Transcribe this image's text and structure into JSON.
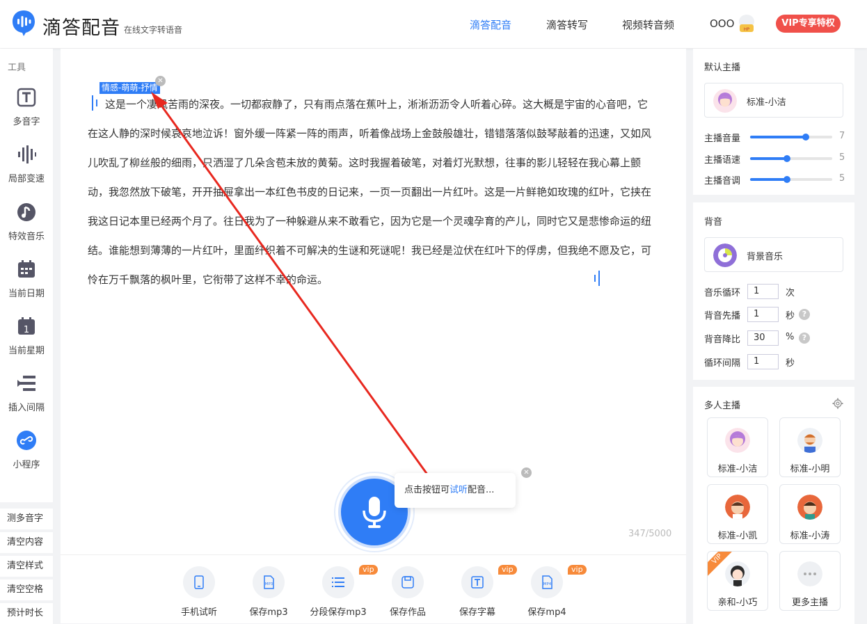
{
  "header": {
    "brand": "滴答配音",
    "brand_sub": "在线文字转语音",
    "nav": [
      "滴答配音",
      "滴答转写",
      "视频转音频"
    ],
    "user_name": "OOO",
    "vip_button": "VIP专享特权"
  },
  "tools": {
    "title": "工具",
    "items": [
      {
        "label": "多音字",
        "icon": "polyphone-icon"
      },
      {
        "label": "局部变速",
        "icon": "speed-icon"
      },
      {
        "label": "特效音乐",
        "icon": "music-effect-icon"
      },
      {
        "label": "当前日期",
        "icon": "calendar-icon"
      },
      {
        "label": "当前星期",
        "icon": "week-icon"
      },
      {
        "label": "插入间隔",
        "icon": "insert-interval-icon"
      },
      {
        "label": "小程序",
        "icon": "mini-program-icon"
      }
    ],
    "buttons": [
      "测多音字",
      "清空内容",
      "清空样式",
      "清空空格",
      "预计时长"
    ]
  },
  "editor": {
    "tag_label": "情感-萌萌-抒情",
    "text": "这是一个凄风苦雨的深夜。一切都寂静了，只有雨点落在蕉叶上，淅淅沥沥令人听着心碎。这大概是宇宙的心音吧，它在这人静的深时候哀哀地泣诉！窗外缓一阵紧一阵的雨声，听着像战场上金鼓般雄壮，错错落落似鼓琴敲着的迅速，又如风儿吹乱了柳丝般的细雨，只洒湿了几朵含苞未放的黄菊。这时我握着破笔，对着灯光默想，往事的影儿轻轻在我心幕上颤动，我忽然放下破笔，开开抽屉拿出一本红色书皮的日记来，一页一页翻出一片红叶。这是一片鲜艳如玫瑰的红叶，它挟在我这日记本里已经两个月了。往日我为了一种躲避从来不敢看它，因为它是一个灵魂孕育的产儿，同时它又是悲惨命运的纽结。谁能想到薄薄的一片红叶，里面纤织着不可解决的生谜和死谜呢！我已经是泣伏在红叶下的俘虏，但我绝不愿及它，可怜在万千飘落的枫叶里，它衔带了这样不幸的命运。",
    "tip_prefix": "点击按钮可",
    "tip_highlight": "试听",
    "tip_suffix": "配音...",
    "char_count": "347/5000"
  },
  "actions": [
    {
      "label": "手机试听",
      "vip": false,
      "icon": "phone-icon"
    },
    {
      "label": "保存mp3",
      "vip": false,
      "icon": "mp3-icon"
    },
    {
      "label": "分段保存mp3",
      "vip": true,
      "icon": "list-icon"
    },
    {
      "label": "保存作品",
      "vip": false,
      "icon": "save-icon"
    },
    {
      "label": "保存字幕",
      "vip": true,
      "icon": "subtitle-icon"
    },
    {
      "label": "保存mp4",
      "vip": true,
      "icon": "mp4-icon"
    }
  ],
  "vip_badge": "vip",
  "default_host": {
    "title": "默认主播",
    "name": "标准-小洁",
    "sliders": [
      {
        "label": "主播音量",
        "value": 7,
        "fraction": 0.68
      },
      {
        "label": "主播语速",
        "value": 5,
        "fraction": 0.45
      },
      {
        "label": "主播音调",
        "value": 5,
        "fraction": 0.45
      }
    ]
  },
  "bgm": {
    "title": "背音",
    "name": "背景音乐",
    "fields": [
      {
        "label": "音乐循环",
        "value": "1",
        "unit": "次",
        "help": false
      },
      {
        "label": "背音先播",
        "value": "1",
        "unit": "秒",
        "help": true
      },
      {
        "label": "背音降比",
        "value": "30",
        "unit": "%",
        "help": true
      },
      {
        "label": "循环间隔",
        "value": "1",
        "unit": "秒",
        "help": false
      }
    ]
  },
  "multi_host": {
    "title": "多人主播",
    "hosts": [
      {
        "name": "标准-小洁",
        "vip": false
      },
      {
        "name": "标准-小明",
        "vip": false
      },
      {
        "name": "标准-小凯",
        "vip": false
      },
      {
        "name": "标准-小涛",
        "vip": false
      },
      {
        "name": "亲和-小巧",
        "vip": true
      },
      {
        "name": "更多主播",
        "vip": false
      }
    ],
    "vip_label": "VIP"
  },
  "colors": {
    "accent": "#2f7df6",
    "vip": "#f0504a",
    "badge": "#f78a3a",
    "arrow": "#e8281f"
  }
}
